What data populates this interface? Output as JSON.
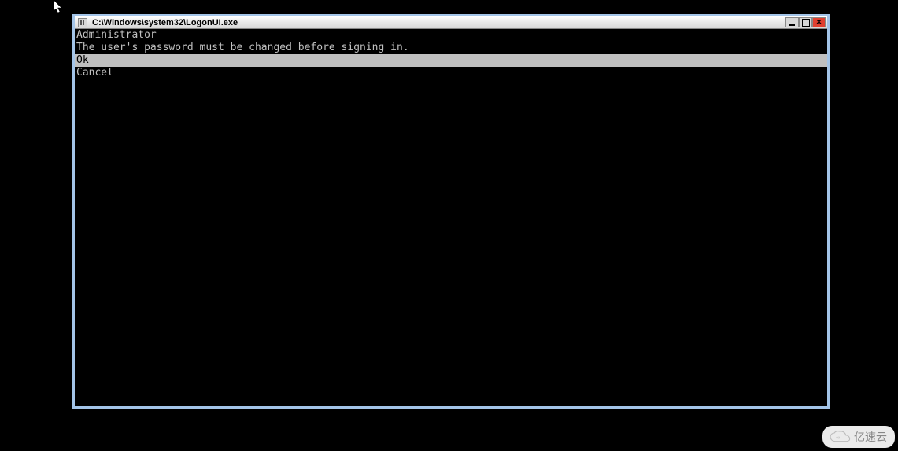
{
  "window": {
    "title": "C:\\Windows\\system32\\LogonUI.exe"
  },
  "console": {
    "user_line": "Administrator",
    "message_line": "The user's password must be changed before signing in.",
    "ok_label": "Ok",
    "cancel_label": "Cancel"
  },
  "watermark": {
    "text": "亿速云"
  }
}
